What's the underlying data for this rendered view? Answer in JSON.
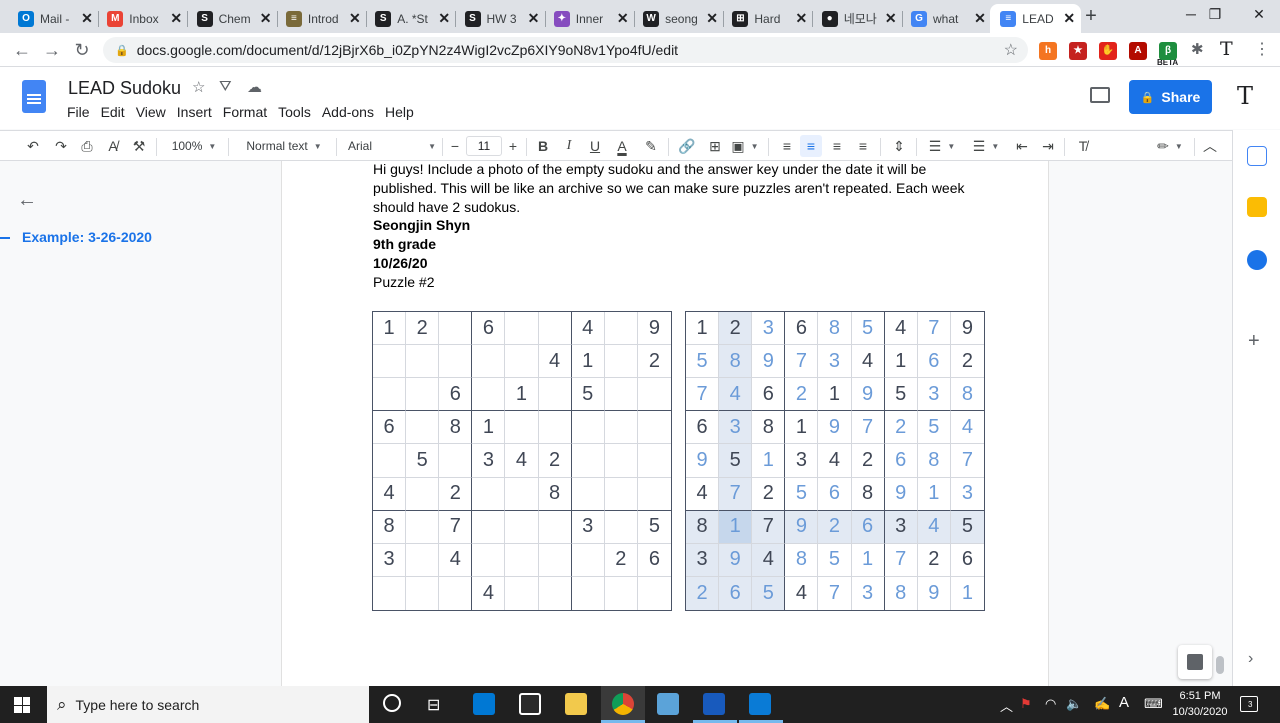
{
  "browser": {
    "tabs": [
      {
        "label": "Mail -",
        "icon": "outlook-icon",
        "color": "#0078d4",
        "glyph": "O"
      },
      {
        "label": "Inbox",
        "icon": "gmail-icon",
        "color": "#ea4335",
        "glyph": "M"
      },
      {
        "label": "Chem",
        "icon": "schoology-icon",
        "color": "#202124",
        "glyph": "S"
      },
      {
        "label": "Introd",
        "icon": "document-icon",
        "color": "#7a6a3a",
        "glyph": "≡"
      },
      {
        "label": "A. *St",
        "icon": "schoology-icon",
        "color": "#202124",
        "glyph": "S"
      },
      {
        "label": "HW 3",
        "icon": "schoology-icon",
        "color": "#202124",
        "glyph": "S"
      },
      {
        "label": "Inner",
        "icon": "kahoot-icon",
        "color": "#864cbf",
        "glyph": "✦"
      },
      {
        "label": "seong",
        "icon": "wikipedia-icon",
        "color": "#202124",
        "glyph": "W"
      },
      {
        "label": "Hard",
        "icon": "sudoku-grid-icon",
        "color": "#202124",
        "glyph": "⊞"
      },
      {
        "label": "네모나",
        "icon": "circle-logo-icon",
        "color": "#202124",
        "glyph": "●"
      },
      {
        "label": "what",
        "icon": "google-icon",
        "color": "#4285f4",
        "glyph": "G"
      },
      {
        "label": "LEAD",
        "icon": "google-docs-icon",
        "color": "#4285f4",
        "glyph": "≡"
      }
    ],
    "url": "docs.google.com/document/d/12jBjrX6b_i0ZpYN2z4WigI2vcZp6XIY9oN8v1Ypo4fU/edit",
    "extensions": [
      {
        "name": "honey-extension-icon",
        "color": "#f47521",
        "glyph": "h"
      },
      {
        "name": "extension-icon",
        "color": "#c5221f",
        "glyph": "★"
      },
      {
        "name": "adblock-icon",
        "color": "#e2231a",
        "glyph": "✋"
      },
      {
        "name": "pdf-icon",
        "color": "#b30b00",
        "glyph": "A"
      },
      {
        "name": "beta-extension-icon",
        "color": "#1e8e3e",
        "glyph": "β"
      }
    ],
    "beta_label": "BETA"
  },
  "docs": {
    "title": "LEAD Sudoku",
    "menu": [
      "File",
      "Edit",
      "View",
      "Insert",
      "Format",
      "Tools",
      "Add-ons",
      "Help"
    ],
    "share_label": "Share",
    "zoom": "100%",
    "style": "Normal text",
    "font": "Arial",
    "font_size": "11",
    "outline_item": "Example: 3-26-2020"
  },
  "content": {
    "intro": "Hi guys! Include a photo of the empty sudoku and the answer key under the date it will be published. This will be like an archive so we can make sure puzzles aren't repeated. Each week should have 2 sudokus.",
    "author": "Seongjin Shyn",
    "grade": "9th grade",
    "date": "10/26/20",
    "puzzle_label": "Puzzle #2"
  },
  "puzzle_grid": [
    [
      1,
      2,
      0,
      6,
      0,
      0,
      4,
      0,
      9
    ],
    [
      0,
      0,
      0,
      0,
      0,
      4,
      1,
      0,
      2
    ],
    [
      0,
      0,
      6,
      0,
      1,
      0,
      5,
      0,
      0
    ],
    [
      6,
      0,
      8,
      1,
      0,
      0,
      0,
      0,
      0
    ],
    [
      0,
      5,
      0,
      3,
      4,
      2,
      0,
      0,
      0
    ],
    [
      4,
      0,
      2,
      0,
      0,
      8,
      0,
      0,
      0
    ],
    [
      8,
      0,
      7,
      0,
      0,
      0,
      3,
      0,
      5
    ],
    [
      3,
      0,
      4,
      0,
      0,
      0,
      0,
      2,
      6
    ],
    [
      0,
      0,
      0,
      4,
      0,
      0,
      0,
      0,
      0
    ]
  ],
  "answer_grid": [
    [
      1,
      2,
      3,
      6,
      8,
      5,
      4,
      7,
      9
    ],
    [
      5,
      8,
      9,
      7,
      3,
      4,
      1,
      6,
      2
    ],
    [
      7,
      4,
      6,
      2,
      1,
      9,
      5,
      3,
      8
    ],
    [
      6,
      3,
      8,
      1,
      9,
      7,
      2,
      5,
      4
    ],
    [
      9,
      5,
      1,
      3,
      4,
      2,
      6,
      8,
      7
    ],
    [
      4,
      7,
      2,
      5,
      6,
      8,
      9,
      1,
      3
    ],
    [
      8,
      1,
      7,
      9,
      2,
      6,
      3,
      4,
      5
    ],
    [
      3,
      9,
      4,
      8,
      5,
      1,
      7,
      2,
      6
    ],
    [
      2,
      6,
      5,
      4,
      7,
      3,
      8,
      9,
      1
    ]
  ],
  "answer_given_mask": [
    [
      1,
      1,
      0,
      1,
      0,
      0,
      1,
      0,
      1
    ],
    [
      0,
      0,
      0,
      0,
      0,
      1,
      1,
      0,
      1
    ],
    [
      0,
      0,
      1,
      0,
      1,
      0,
      1,
      0,
      0
    ],
    [
      1,
      0,
      1,
      1,
      0,
      0,
      0,
      0,
      0
    ],
    [
      0,
      1,
      0,
      1,
      1,
      1,
      0,
      0,
      0
    ],
    [
      1,
      0,
      1,
      0,
      0,
      1,
      0,
      0,
      0
    ],
    [
      1,
      0,
      1,
      0,
      0,
      0,
      1,
      0,
      1
    ],
    [
      1,
      0,
      1,
      0,
      0,
      0,
      0,
      1,
      1
    ],
    [
      0,
      0,
      0,
      1,
      0,
      0,
      0,
      0,
      0
    ]
  ],
  "answer_selected_cell": [
    6,
    1
  ],
  "taskbar": {
    "search_placeholder": "Type here to search",
    "time": "6:51 PM",
    "date": "10/30/2020",
    "notification_count": "3",
    "ime_label": "A"
  }
}
